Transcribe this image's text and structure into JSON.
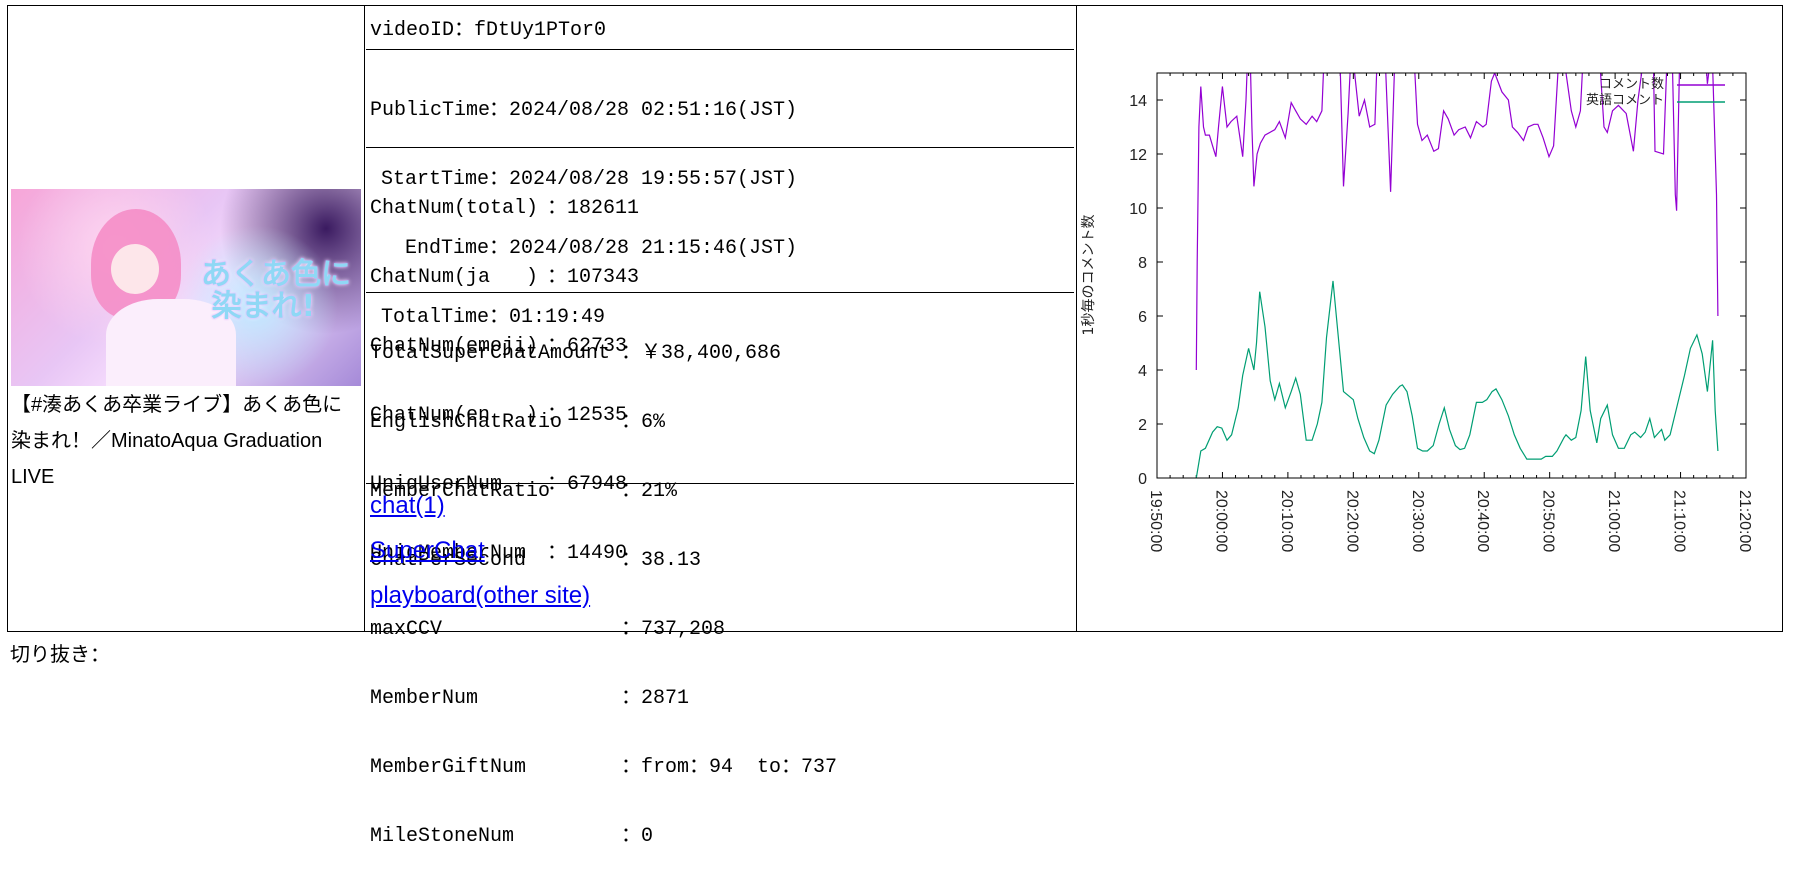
{
  "video": {
    "title": "【#湊あくあ卒業ライブ】あくあ色に染まれ！／MinatoAqua Graduation LIVE",
    "thumbnail_lettering": "あくあ色に染まれ!"
  },
  "info": {
    "video_id_label": "videoID",
    "video_id": "fDtUy1PTor0",
    "times": [
      {
        "label": "PublicTime",
        "value": "2024/08/28 02:51:16(JST)"
      },
      {
        "label": "StartTime",
        "value": "2024/08/28 19:55:57(JST)"
      },
      {
        "label": "EndTime",
        "value": "2024/08/28 21:15:46(JST)"
      },
      {
        "label": "TotalTime",
        "value": "01:19:49"
      }
    ],
    "counts": [
      {
        "label": "ChatNum(total)",
        "value": "182611"
      },
      {
        "label": "ChatNum(ja   )",
        "value": "107343"
      },
      {
        "label": "ChatNum(emoji)",
        "value": "62733"
      },
      {
        "label": "ChatNum(en   )",
        "value": "12535"
      },
      {
        "label": "UniqUserNum",
        "value": "67948"
      },
      {
        "label": "UniqMemberNum",
        "value": "14490"
      }
    ],
    "stats": [
      {
        "label": "TotalSuperChatAmount",
        "value": "￥38,400,686"
      },
      {
        "label": "EnglishChatRatio",
        "value": "6%"
      },
      {
        "label": "MemberChatRatio",
        "value": "21%"
      },
      {
        "label": "ChatPerSecond",
        "value": "38.13"
      },
      {
        "label": "maxCCV",
        "value": "737,208"
      },
      {
        "label": "MemberNum",
        "value": "2871"
      },
      {
        "label": "MemberGiftNum",
        "value": "from：94  to：737"
      },
      {
        "label": "MileStoneNum",
        "value": "0"
      }
    ],
    "sep": "：",
    "links": [
      "chat(1)",
      "SuperChat",
      "playboard(other site)"
    ]
  },
  "footer_text": "切り抜き：",
  "chart_data": {
    "type": "line",
    "title": "",
    "xlabel": "",
    "ylabel": "1秒毎のコメント数",
    "x_unit": "minutes since 19:50:00",
    "xlim": [
      0,
      90
    ],
    "ylim": [
      0,
      15
    ],
    "x_ticks": [
      0,
      10,
      20,
      30,
      40,
      50,
      60,
      70,
      80,
      90
    ],
    "x_tick_labels": [
      "19:50:00",
      "20:00:00",
      "20:10:00",
      "20:20:00",
      "20:30:00",
      "20:40:00",
      "20:50:00",
      "21:00:00",
      "21:10:00",
      "21:20:00"
    ],
    "y_ticks": [
      0,
      2,
      4,
      6,
      8,
      10,
      12,
      14
    ],
    "y_tick_labels": [
      "0",
      "2",
      "4",
      "6",
      "8",
      "10",
      "12",
      "14"
    ],
    "grid": false,
    "legend_position": "top-right",
    "series": [
      {
        "name": "コメント数",
        "color": "#9400d3",
        "points": [
          [
            6.0,
            4
          ],
          [
            6.15,
            8
          ],
          [
            6.4,
            13
          ],
          [
            6.7,
            14.5
          ],
          [
            7.1,
            13
          ],
          [
            7.4,
            12.7
          ],
          [
            8.0,
            12.7
          ],
          [
            8.5,
            12.3
          ],
          [
            9.0,
            11.9
          ],
          [
            9.4,
            13
          ],
          [
            10.0,
            14.5
          ],
          [
            10.7,
            13
          ],
          [
            11.3,
            13.2
          ],
          [
            12.2,
            13.4
          ],
          [
            13.1,
            11.9
          ],
          [
            13.6,
            14
          ],
          [
            13.9,
            16
          ],
          [
            14.3,
            15
          ],
          [
            14.5,
            13
          ],
          [
            14.8,
            10.8
          ],
          [
            15.3,
            12.0
          ],
          [
            15.8,
            12.4
          ],
          [
            16.5,
            12.7
          ],
          [
            18.0,
            12.9
          ],
          [
            18.7,
            13.2
          ],
          [
            19.6,
            12.6
          ],
          [
            20.5,
            13.9
          ],
          [
            21.2,
            13.6
          ],
          [
            21.9,
            13.3
          ],
          [
            22.8,
            13.1
          ],
          [
            23.7,
            13.4
          ],
          [
            24.4,
            13.2
          ],
          [
            25.2,
            13.6
          ],
          [
            25.6,
            16
          ],
          [
            27.9,
            16
          ],
          [
            28.5,
            10.8
          ],
          [
            29.2,
            13.5
          ],
          [
            29.7,
            16
          ],
          [
            30.2,
            15
          ],
          [
            30.9,
            13.4
          ],
          [
            31.7,
            14
          ],
          [
            32.5,
            13
          ],
          [
            33.3,
            13.1
          ],
          [
            33.7,
            16
          ],
          [
            34.8,
            16
          ],
          [
            35.7,
            10.6
          ],
          [
            36.4,
            16
          ],
          [
            39.2,
            16
          ],
          [
            39.8,
            13.1
          ],
          [
            40.5,
            12.5
          ],
          [
            41.3,
            12.7
          ],
          [
            42.3,
            12.1
          ],
          [
            43.0,
            12.2
          ],
          [
            43.8,
            13.6
          ],
          [
            44.5,
            13.3
          ],
          [
            45.4,
            12.7
          ],
          [
            46.1,
            12.9
          ],
          [
            47.1,
            13.0
          ],
          [
            47.9,
            12.6
          ],
          [
            48.8,
            13.2
          ],
          [
            49.8,
            13.0
          ],
          [
            50.3,
            13.1
          ],
          [
            51.1,
            14.7
          ],
          [
            51.6,
            15
          ],
          [
            52.7,
            14.3
          ],
          [
            53.7,
            14.0
          ],
          [
            54.3,
            13.0
          ],
          [
            55.1,
            12.8
          ],
          [
            56.0,
            12.5
          ],
          [
            56.7,
            13
          ],
          [
            57.6,
            13.1
          ],
          [
            58.2,
            13.1
          ],
          [
            59.0,
            12.6
          ],
          [
            59.9,
            11.9
          ],
          [
            60.6,
            12.3
          ],
          [
            61.5,
            16
          ],
          [
            62.5,
            15
          ],
          [
            63.3,
            13.6
          ],
          [
            64.0,
            13
          ],
          [
            64.7,
            13.6
          ],
          [
            65.2,
            16
          ],
          [
            67.5,
            16
          ],
          [
            68.3,
            13
          ],
          [
            68.8,
            12.8
          ],
          [
            69.6,
            13.6
          ],
          [
            70.5,
            13.8
          ],
          [
            71.7,
            13.5
          ],
          [
            72.8,
            12.1
          ],
          [
            73.5,
            14
          ],
          [
            74.6,
            16
          ],
          [
            75.8,
            16
          ],
          [
            76.1,
            12.1
          ],
          [
            77.4,
            12
          ],
          [
            78.0,
            16
          ],
          [
            78.7,
            16
          ],
          [
            79.2,
            10.5
          ],
          [
            79.4,
            9.9
          ],
          [
            79.9,
            16
          ],
          [
            83.7,
            16
          ],
          [
            84.1,
            14.6
          ],
          [
            84.8,
            16
          ],
          [
            85.5,
            10.5
          ],
          [
            85.7,
            6
          ]
        ]
      },
      {
        "name": "英語コメント",
        "color": "#009e73",
        "points": [
          [
            6.0,
            0
          ],
          [
            6.7,
            1.0
          ],
          [
            7.4,
            1.1
          ],
          [
            8.5,
            1.7
          ],
          [
            9.2,
            1.9
          ],
          [
            9.9,
            1.85
          ],
          [
            10.7,
            1.4
          ],
          [
            11.4,
            1.6
          ],
          [
            12.4,
            2.6
          ],
          [
            13.1,
            3.8
          ],
          [
            14.0,
            4.8
          ],
          [
            14.8,
            4.0
          ],
          [
            15.2,
            5
          ],
          [
            15.7,
            6.9
          ],
          [
            16.5,
            5.6
          ],
          [
            17.3,
            3.6
          ],
          [
            18.0,
            2.9
          ],
          [
            18.7,
            3.5
          ],
          [
            19.6,
            2.6
          ],
          [
            20.5,
            3.2
          ],
          [
            21.2,
            3.7
          ],
          [
            21.9,
            3.1
          ],
          [
            22.8,
            1.4
          ],
          [
            23.7,
            1.4
          ],
          [
            24.5,
            2.0
          ],
          [
            25.2,
            2.8
          ],
          [
            25.9,
            5.2
          ],
          [
            26.9,
            7.3
          ],
          [
            27.6,
            5.5
          ],
          [
            28.5,
            3.2
          ],
          [
            30.0,
            2.9
          ],
          [
            30.7,
            2.2
          ],
          [
            31.6,
            1.5
          ],
          [
            32.5,
            1.0
          ],
          [
            33.2,
            0.9
          ],
          [
            33.9,
            1.4
          ],
          [
            35.0,
            2.7
          ],
          [
            36.0,
            3.1
          ],
          [
            37.1,
            3.4
          ],
          [
            37.5,
            3.45
          ],
          [
            38.2,
            3.2
          ],
          [
            39.0,
            2.3
          ],
          [
            39.8,
            1.1
          ],
          [
            40.6,
            1.0
          ],
          [
            41.3,
            1.0
          ],
          [
            42.2,
            1.2
          ],
          [
            43.1,
            2.0
          ],
          [
            43.9,
            2.6
          ],
          [
            44.7,
            1.8
          ],
          [
            45.6,
            1.2
          ],
          [
            46.3,
            1.05
          ],
          [
            47.0,
            1.1
          ],
          [
            47.8,
            1.6
          ],
          [
            48.8,
            2.8
          ],
          [
            49.7,
            2.8
          ],
          [
            50.4,
            2.9
          ],
          [
            51.2,
            3.2
          ],
          [
            51.8,
            3.3
          ],
          [
            52.7,
            2.9
          ],
          [
            53.7,
            2.3
          ],
          [
            54.6,
            1.6
          ],
          [
            55.5,
            1.1
          ],
          [
            56.5,
            0.7
          ],
          [
            57.6,
            0.7
          ],
          [
            58.7,
            0.7
          ],
          [
            59.4,
            0.8
          ],
          [
            60.4,
            0.8
          ],
          [
            61.1,
            1.0
          ],
          [
            62.2,
            1.5
          ],
          [
            62.5,
            1.6
          ],
          [
            63.3,
            1.4
          ],
          [
            64.0,
            1.5
          ],
          [
            64.8,
            2.5
          ],
          [
            65.5,
            4.5
          ],
          [
            66.2,
            2.5
          ],
          [
            67.2,
            1.3
          ],
          [
            67.8,
            2.2
          ],
          [
            68.8,
            2.7
          ],
          [
            69.6,
            1.6
          ],
          [
            70.5,
            1.1
          ],
          [
            71.4,
            1.1
          ],
          [
            72.4,
            1.6
          ],
          [
            73.0,
            1.7
          ],
          [
            73.9,
            1.5
          ],
          [
            74.6,
            1.7
          ],
          [
            75.3,
            2.2
          ],
          [
            76.0,
            1.5
          ],
          [
            77.1,
            1.8
          ],
          [
            77.6,
            1.4
          ],
          [
            78.4,
            1.6
          ],
          [
            79.5,
            2.7
          ],
          [
            80.6,
            3.8
          ],
          [
            81.5,
            4.8
          ],
          [
            82.5,
            5.3
          ],
          [
            83.3,
            4.6
          ],
          [
            84.1,
            3.2
          ],
          [
            84.9,
            5.1
          ],
          [
            85.3,
            2.5
          ],
          [
            85.7,
            1.0
          ]
        ]
      }
    ]
  }
}
